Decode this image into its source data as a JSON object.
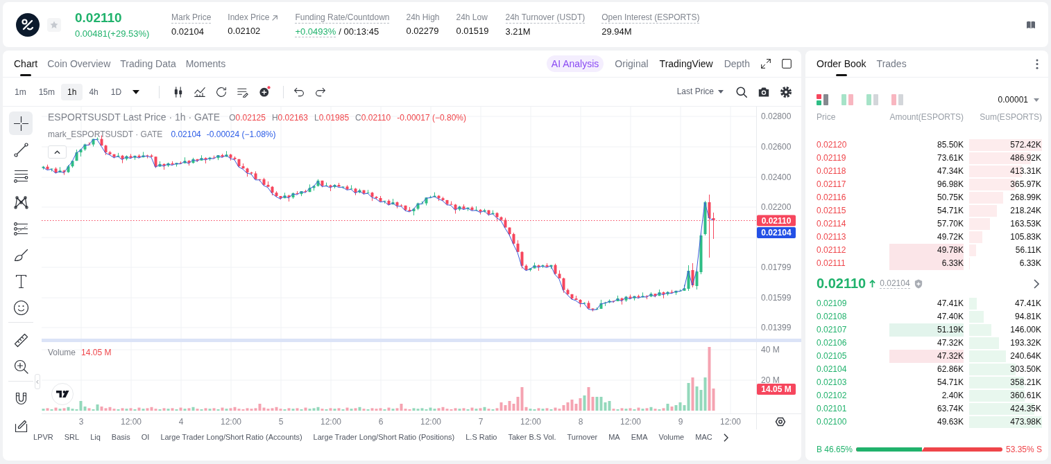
{
  "ticker": {
    "price": "0.02110",
    "change": "0.00481(+29.53%)",
    "rising": true,
    "favorite": false,
    "stats": [
      {
        "kind": "plain",
        "label": "Mark Price",
        "value": "0.02104",
        "tooltip": true
      },
      {
        "kind": "link",
        "label": "Index Price",
        "value": "0.02102",
        "tooltip": false
      },
      {
        "kind": "funding",
        "label": "Funding Rate/Countdown",
        "rate": "+0.0493%",
        "countdown": "/ 00:13:45",
        "tooltip": true
      },
      {
        "kind": "plain",
        "label": "24h High",
        "value": "0.02279",
        "tooltip": false
      },
      {
        "kind": "plain",
        "label": "24h Low",
        "value": "0.01519",
        "tooltip": false
      },
      {
        "kind": "plain",
        "label": "24h Turnover (USDT)",
        "value": "3.21M",
        "tooltip": true
      },
      {
        "kind": "plain",
        "label": "Open Interest (ESPORTS)",
        "value": "29.94M",
        "tooltip": true
      }
    ]
  },
  "chart_panel": {
    "tabs": [
      {
        "label": "Chart",
        "selected": true
      },
      {
        "label": "Coin Overview",
        "selected": false
      },
      {
        "label": "Trading Data",
        "selected": false
      },
      {
        "label": "Moments",
        "selected": false
      }
    ],
    "views": [
      {
        "kind": "ai",
        "label": "AI Analysis",
        "selected": false
      },
      {
        "kind": "plain",
        "label": "Original",
        "selected": false
      },
      {
        "kind": "plain",
        "label": "TradingView",
        "selected": true
      },
      {
        "kind": "plain",
        "label": "Depth",
        "selected": false
      }
    ],
    "intervals": [
      {
        "label": "1m",
        "selected": false
      },
      {
        "label": "15m",
        "selected": false
      },
      {
        "label": "1h",
        "selected": true
      },
      {
        "label": "4h",
        "selected": false
      },
      {
        "label": "1D",
        "selected": false
      }
    ],
    "indicator_alert": true,
    "price_source": "Last Price",
    "drawing_tools": [
      {
        "selected": true
      },
      {
        "selected": false
      },
      {
        "selected": false
      },
      {
        "selected": false
      },
      {
        "selected": false
      },
      {
        "selected": false
      },
      {
        "selected": false
      },
      {
        "selected": false
      },
      {
        "selected": false
      },
      {
        "selected": false
      },
      {
        "selected": false
      },
      {
        "selected": false
      }
    ]
  },
  "chart": {
    "title": "ESPORTSUSDT Last Price · 1h · GATE",
    "falling": true,
    "ohlc": [
      {
        "key": "O",
        "value": "0.02125"
      },
      {
        "key": "H",
        "value": "0.02163"
      },
      {
        "key": "L",
        "value": "0.01985"
      },
      {
        "key": "C",
        "value": "0.02110"
      }
    ],
    "change": "-0.00017 (−0.80%)",
    "mark_title": "mark_ESPORTSUSDT · GATE",
    "mark_value": "0.02104",
    "mark_change": "-0.00024 (−1.08%)",
    "price_ticks": [
      "0.02800",
      "0.02600",
      "0.02400",
      "0.02200",
      "0.01799",
      "0.01599",
      "0.01399"
    ],
    "last_price_tag": "0.02110",
    "mark_price_tag": "0.02104",
    "volume_title": "Volume",
    "volume_value": "14.05 M",
    "volume_ticks": [
      "40 M",
      "20 M"
    ],
    "volume_tag": "14.05 M",
    "time_ticks": [
      "3",
      "12:00",
      "4",
      "12:00",
      "5",
      "12:00",
      "6",
      "12:00",
      "7",
      "12:00",
      "8",
      "12:00",
      "9",
      "12:00"
    ]
  },
  "indicators": [
    "LPVR",
    "SRL",
    "Liq",
    "Basis",
    "OI",
    "Large Trader Long/Short Ratio (Accounts)",
    "Large Trader Long/Short Ratio (Positions)",
    "L.S Ratio",
    "Taker B.S Vol.",
    "Turnover",
    "MA",
    "EMA",
    "Volume",
    "MAC"
  ],
  "order_book": {
    "tabs": [
      {
        "label": "Order Book",
        "selected": true
      },
      {
        "label": "Trades",
        "selected": false
      }
    ],
    "layouts": [
      {
        "selected": true
      },
      {
        "selected": false
      },
      {
        "selected": false
      },
      {
        "selected": false
      }
    ],
    "precision": "0.00001",
    "columns": [
      "Price",
      "Amount(ESPORTS)",
      "Sum(ESPORTS)"
    ],
    "asks": [
      {
        "price": "0.02120",
        "amount": "85.50K",
        "sum": "572.42K",
        "highlighted": false
      },
      {
        "price": "0.02119",
        "amount": "73.61K",
        "sum": "486.92K",
        "highlighted": false
      },
      {
        "price": "0.02118",
        "amount": "47.34K",
        "sum": "413.31K",
        "highlighted": false
      },
      {
        "price": "0.02117",
        "amount": "96.98K",
        "sum": "365.97K",
        "highlighted": false
      },
      {
        "price": "0.02116",
        "amount": "50.75K",
        "sum": "268.99K",
        "highlighted": false
      },
      {
        "price": "0.02115",
        "amount": "54.71K",
        "sum": "218.24K",
        "highlighted": false
      },
      {
        "price": "0.02114",
        "amount": "57.70K",
        "sum": "163.53K",
        "highlighted": false
      },
      {
        "price": "0.02113",
        "amount": "49.72K",
        "sum": "105.83K",
        "highlighted": false
      },
      {
        "price": "0.02112",
        "amount": "49.78K",
        "sum": "56.11K",
        "highlighted": true,
        "color": "#fbe5e8"
      },
      {
        "price": "0.02111",
        "amount": "6.33K",
        "sum": "6.33K",
        "highlighted": true,
        "color": "#fbe5e8"
      }
    ],
    "rising": true,
    "last_price": "0.02110",
    "mark_price": "0.02104",
    "bids": [
      {
        "price": "0.02109",
        "amount": "47.41K",
        "sum": "47.41K",
        "highlighted": false
      },
      {
        "price": "0.02108",
        "amount": "47.40K",
        "sum": "94.81K",
        "highlighted": false
      },
      {
        "price": "0.02107",
        "amount": "51.19K",
        "sum": "146.00K",
        "highlighted": true,
        "color": "#e2f4ec"
      },
      {
        "price": "0.02106",
        "amount": "47.32K",
        "sum": "193.32K",
        "highlighted": false
      },
      {
        "price": "0.02105",
        "amount": "47.32K",
        "sum": "240.64K",
        "highlighted": true,
        "color": "#fbe5e8"
      },
      {
        "price": "0.02104",
        "amount": "62.86K",
        "sum": "303.50K",
        "highlighted": false
      },
      {
        "price": "0.02103",
        "amount": "54.71K",
        "sum": "358.21K",
        "highlighted": false
      },
      {
        "price": "0.02102",
        "amount": "2.40K",
        "sum": "360.61K",
        "highlighted": false
      },
      {
        "price": "0.02101",
        "amount": "63.74K",
        "sum": "424.35K",
        "highlighted": false
      },
      {
        "price": "0.02100",
        "amount": "49.63K",
        "sum": "473.98K",
        "highlighted": false
      }
    ],
    "ratio": {
      "buy": "B 46.65%",
      "sell": "53.35% S",
      "level": 0.4665
    }
  }
}
